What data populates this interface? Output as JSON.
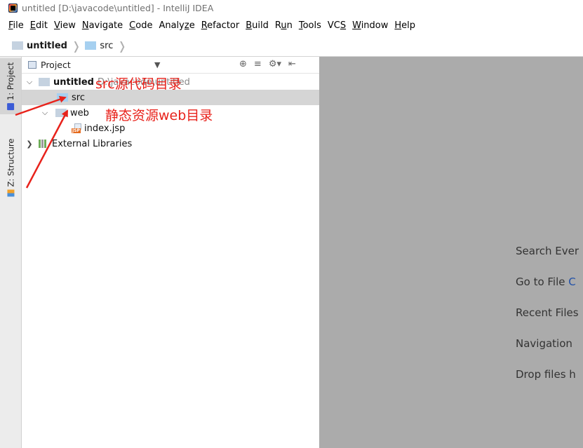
{
  "window": {
    "title": "untitled [D:\\javacode\\untitled] - IntelliJ IDEA"
  },
  "menu": [
    {
      "pre": "",
      "u": "F",
      "post": "ile"
    },
    {
      "pre": "",
      "u": "E",
      "post": "dit"
    },
    {
      "pre": "",
      "u": "V",
      "post": "iew"
    },
    {
      "pre": "",
      "u": "N",
      "post": "avigate"
    },
    {
      "pre": "",
      "u": "C",
      "post": "ode"
    },
    {
      "pre": "Analy",
      "u": "z",
      "post": "e"
    },
    {
      "pre": "",
      "u": "R",
      "post": "efactor"
    },
    {
      "pre": "",
      "u": "B",
      "post": "uild"
    },
    {
      "pre": "R",
      "u": "u",
      "post": "n"
    },
    {
      "pre": "",
      "u": "T",
      "post": "ools"
    },
    {
      "pre": "VC",
      "u": "S",
      "post": ""
    },
    {
      "pre": "",
      "u": "W",
      "post": "indow"
    },
    {
      "pre": "",
      "u": "H",
      "post": "elp"
    }
  ],
  "breadcrumb": {
    "project": "untitled",
    "folder": "src"
  },
  "side_tabs": {
    "project": "1: Project",
    "structure": "Z: Structure"
  },
  "panel": {
    "title": "Project",
    "icons": [
      "crosshair-icon",
      "collapse-all-icon",
      "settings-gear-icon",
      "hide-panel-icon"
    ]
  },
  "tree": [
    {
      "label": "untitled",
      "path_suffix": "D:\\javacode\\untitled",
      "expanded": true,
      "icon": "module-folder-icon"
    },
    {
      "label": "src",
      "icon": "source-folder-icon",
      "selected": true
    },
    {
      "label": "web",
      "expanded": true,
      "icon": "web-folder-icon"
    },
    {
      "label": "index.jsp",
      "icon": "jsp-file-icon"
    },
    {
      "label": "External Libraries",
      "expanded": false,
      "icon": "libraries-icon"
    }
  ],
  "editor_hints": [
    {
      "text": "Search Ever",
      "key": ""
    },
    {
      "text": "Go to File ",
      "key": "C"
    },
    {
      "text": "Recent Files",
      "key": ""
    },
    {
      "text": "Navigation",
      "key": ""
    },
    {
      "text": "Drop files h",
      "key": ""
    }
  ],
  "annotations": {
    "src_note": "src源代码目录",
    "web_note": "静态资源web目录",
    "color": "#e8221b"
  },
  "colors": {
    "editor_bg": "#ababab",
    "selection_bg": "#d5d5d5",
    "source_folder": "#a6d0f0"
  }
}
